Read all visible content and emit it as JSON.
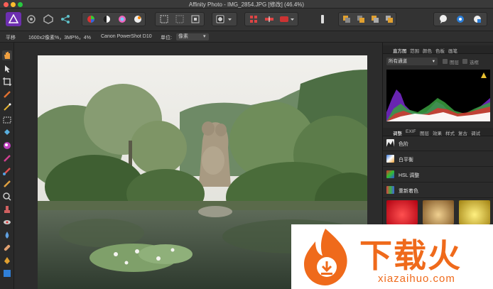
{
  "window": {
    "title": "Affinity Photo - IMG_2854.JPG [修改] (46.4%)"
  },
  "context_bar": {
    "tool_name": "平移",
    "image_info": "1600x2像素%，3MP%，4%",
    "camera": "Canon PowerShot D10",
    "unit_label": "单位:",
    "unit_value": "像素"
  },
  "panels": {
    "top_tabs": [
      "直方图",
      "范围",
      "颜色",
      "色板",
      "画笔"
    ],
    "active_top_tab": "直方图",
    "channel": "所有通道",
    "checkbox_layer": "图层",
    "checkbox_marquee": "选框",
    "bottom_tabs": [
      "调整",
      "EXIF",
      "图层",
      "效果",
      "样式",
      "复古",
      "调试"
    ],
    "active_bottom_tab": "调整",
    "adjustments": [
      {
        "label": "色阶",
        "icon": "levels-icon"
      },
      {
        "label": "白平衡",
        "icon": "white-balance-icon"
      },
      {
        "label": "HSL 调整",
        "icon": "hsl-icon"
      },
      {
        "label": "重新着色",
        "icon": "recolor-icon"
      }
    ]
  },
  "watermark": {
    "brand": "下载火",
    "url": "xiazaihuo.com"
  },
  "colors": {
    "accent": "#7b3fbf",
    "watermark_orange": "#ef6a1b"
  }
}
